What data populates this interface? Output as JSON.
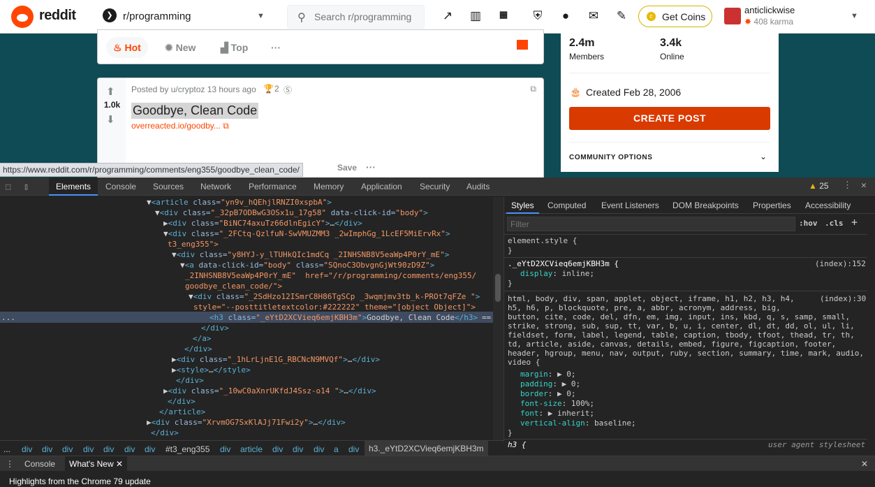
{
  "header": {
    "brand": "reddit",
    "subreddit": "r/programming",
    "search_placeholder": "Search r/programming",
    "coins_label": "Get Coins",
    "username": "anticlickwise",
    "karma": "408 karma"
  },
  "sort": {
    "hot": "Hot",
    "new": "New",
    "top": "Top",
    "more": "···"
  },
  "post": {
    "votes": "1.0k",
    "meta": "Posted by u/cryptoz 13 hours ago",
    "awards": "2",
    "title": "Goodbye, Clean Code",
    "link": "overreacted.io/goodby...",
    "save": "Save",
    "more": "···"
  },
  "sidebar": {
    "members_value": "2.4m",
    "members_label": "Members",
    "online_value": "3.4k",
    "online_label": "Online",
    "created": "Created Feb 28, 2006",
    "create_post": "CREATE POST",
    "community_options": "COMMUNITY OPTIONS"
  },
  "status_url": "https://www.reddit.com/r/programming/comments/eng355/goodbye_clean_code/",
  "devtools": {
    "tabs": [
      "Elements",
      "Console",
      "Sources",
      "Network",
      "Performance",
      "Memory",
      "Application",
      "Security",
      "Audits"
    ],
    "warnings": "25",
    "style_tabs": [
      "Styles",
      "Computed",
      "Event Listeners",
      "DOM Breakpoints",
      "Properties",
      "Accessibility"
    ],
    "filter_placeholder": "Filter",
    "hov": ":hov",
    "cls": ".cls",
    "tree": [
      {
        "indent": 220,
        "arrow": "▼",
        "tag": "article",
        "attrs": [
          [
            "class",
            "yn9v_hQEhjlRNZI0xspbA"
          ]
        ],
        "close": false
      },
      {
        "indent": 232,
        "arrow": "▼",
        "tag": "div",
        "attrs": [
          [
            "class",
            "_32pB7ODBwG3OSx1u_17g58"
          ],
          [
            "data-click-id",
            "body"
          ]
        ],
        "close": false
      },
      {
        "indent": 244,
        "arrow": "▶",
        "tag": "div",
        "attrs": [
          [
            "class",
            "BiNC74axuTz66dlnEgicY"
          ]
        ],
        "close": true
      },
      {
        "indent": 244,
        "arrow": "▼",
        "tag": "div",
        "attrs": [
          [
            "class",
            "_2FCtq-QzlfuN-SwVMUZMM3 _2wImphGg_1LcEF5MiErvRx"
          ]
        ],
        "close": false
      },
      {
        "indent": 240,
        "arrow": "",
        "raw": "t3_eng355\">",
        "rawclass": "av"
      },
      {
        "indent": 256,
        "arrow": "▼",
        "tag": "div",
        "attrs": [
          [
            "class",
            "y8HYJ-y_lTUHkQIc1mdCq _2INHSNB8V5eaWp4P0rY_mE"
          ]
        ],
        "close": false
      },
      {
        "indent": 268,
        "arrow": "▼",
        "tag": "a",
        "attrs": [
          [
            "data-click-id",
            "body"
          ],
          [
            "class",
            "SQnoC3ObvgnGjWt90zD9Z"
          ]
        ],
        "close": false
      },
      {
        "indent": 265,
        "arrow": "",
        "raw": "_2INHSNB8V5eaWp4P0rY_mE\"  href=\"/r/programming/comments/eng355/",
        "rawclass": "av"
      },
      {
        "indent": 265,
        "arrow": "",
        "raw": "goodbye_clean_code/\">",
        "rawclass": "av"
      },
      {
        "indent": 280,
        "arrow": "▼",
        "tag": "div",
        "attrs": [
          [
            "class",
            "_2SdHzo12ISmrC8H86TgSCp _3wqmjmv3tb_k-PROt7qFZe "
          ]
        ],
        "close": false
      },
      {
        "indent": 277,
        "arrow": "",
        "raw": "style=\"--posttitletextcolor:#222222\" theme=\"[object Object]\">",
        "rawclass": "av"
      },
      {
        "indent": 300,
        "arrow": "",
        "tag": "h3",
        "attrs": [
          [
            "class",
            "_eYtD2XCVieq6emjKBH3m"
          ]
        ],
        "text": "Goodbye, Clean Code",
        "selected": true
      },
      {
        "indent": 288,
        "arrow": "",
        "raw": "</div>",
        "rawclass": "tg"
      },
      {
        "indent": 276,
        "arrow": "",
        "raw": "</a>",
        "rawclass": "tg"
      },
      {
        "indent": 264,
        "arrow": "",
        "raw": "</div>",
        "rawclass": "tg"
      },
      {
        "indent": 256,
        "arrow": "▶",
        "tag": "div",
        "attrs": [
          [
            "class",
            "_1hLrLjnE1G_RBCNcN9MVQf"
          ]
        ],
        "close": true
      },
      {
        "indent": 256,
        "arrow": "▶",
        "tag": "style",
        "attrs": [],
        "close": true
      },
      {
        "indent": 252,
        "arrow": "",
        "raw": "</div>",
        "rawclass": "tg"
      },
      {
        "indent": 244,
        "arrow": "▶",
        "tag": "div",
        "attrs": [
          [
            "class",
            "_10wC0aXnrUKfdJ4Ssz-o14 "
          ]
        ],
        "close": true
      },
      {
        "indent": 240,
        "arrow": "",
        "raw": "</div>",
        "rawclass": "tg"
      },
      {
        "indent": 228,
        "arrow": "",
        "raw": "</article>",
        "rawclass": "tg"
      },
      {
        "indent": 220,
        "arrow": "▶",
        "tag": "div",
        "attrs": [
          [
            "class",
            "XrvmOG7SxKlAJj71Fwi2y"
          ]
        ],
        "close": true
      },
      {
        "indent": 216,
        "arrow": "",
        "raw": "</div>",
        "rawclass": "tg"
      }
    ],
    "styles": {
      "element_style": "element.style {",
      "rule1_selector": "._eYtD2XCVieq6emjKBH3m {",
      "rule1_source": "(index):152",
      "rule1_prop": "display",
      "rule1_val": "inline;",
      "rule2_selector_lines": [
        "html, body, div, span, applet, object, iframe, h1, h2, h3, h4,",
        "h5, h6, p, blockquote, pre, a, abbr, acronym, address, big,",
        "button, cite, code, del, dfn, em, img, input, ins, kbd, q, s, samp, small,",
        "strike, strong, sub, sup, tt, var, b, u, i, center, dl, dt, dd, ol, ul, li,",
        "fieldset, form, label, legend, table, caption, tbody, tfoot, thead, tr, th,",
        "td, article, aside, canvas, details, embed, figure, figcaption, footer,",
        "header, hgroup, menu, nav, output, ruby, section, summary, time, mark, audio,",
        "video {"
      ],
      "rule2_source": "(index):30",
      "rule2_props": [
        [
          "margin",
          "▶ 0;"
        ],
        [
          "padding",
          "▶ 0;"
        ],
        [
          "border",
          "▶ 0;"
        ],
        [
          "font-size",
          "100%;"
        ],
        [
          "font",
          "▶ inherit;"
        ],
        [
          "vertical-align",
          "baseline;"
        ]
      ],
      "last_selector": "h3 {",
      "last_source": "user agent stylesheet"
    },
    "breadcrumbs": [
      "...",
      "div",
      "div",
      "div",
      "div",
      "div",
      "div",
      "div",
      "#t3_eng355",
      "div",
      "article",
      "div",
      "div",
      "div",
      "a",
      "div",
      "h3._eYtD2XCVieq6emjKBH3m"
    ],
    "drawer_tabs": [
      "Console",
      "What's New"
    ],
    "whats_new": "Highlights from the Chrome 79 update"
  }
}
